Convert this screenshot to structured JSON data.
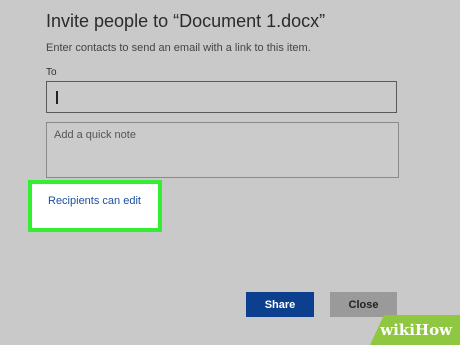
{
  "dialog": {
    "title": "Invite people to “Document 1.docx”",
    "subtitle": "Enter contacts to send an email with a link to this item.",
    "to_label": "To",
    "to_value": "",
    "note_placeholder": "Add a quick note",
    "permission_link": "Recipients can edit",
    "share_label": "Share",
    "close_label": "Close"
  },
  "colors": {
    "background": "#c9c9c9",
    "share_button": "#0d3f8f",
    "close_button": "#9a9a9a",
    "highlight_border": "#33ee33",
    "link": "#1b4f9c"
  },
  "watermark": {
    "text": "wikiHow"
  }
}
